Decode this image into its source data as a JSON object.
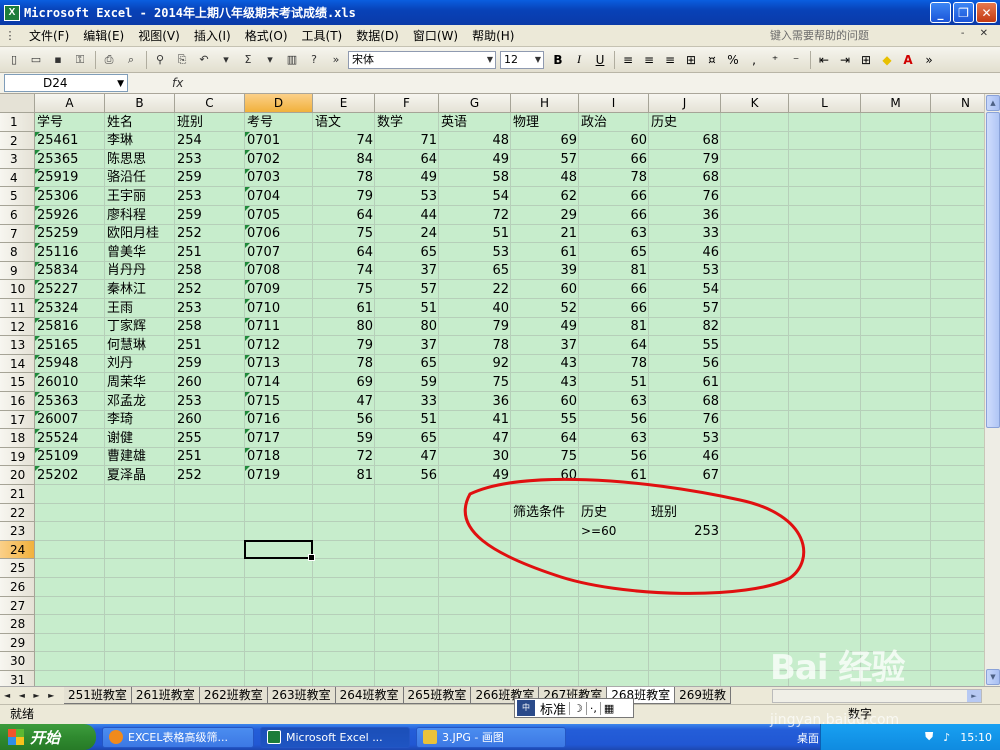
{
  "window": {
    "title": "Microsoft Excel - 2014年上期八年级期末考试成绩.xls",
    "app_icon": "X",
    "buttons": [
      "_",
      "❐",
      "✕"
    ]
  },
  "menu": {
    "items": [
      "文件(F)",
      "编辑(E)",
      "视图(V)",
      "插入(I)",
      "格式(O)",
      "工具(T)",
      "数据(D)",
      "窗口(W)",
      "帮助(H)"
    ],
    "help_placeholder": "键入需要帮助的问题",
    "help_close": "- ✕"
  },
  "toolbar": {
    "font_name": "宋体",
    "font_size": "12",
    "bold": "B",
    "italic": "I",
    "underline": "U",
    "sigma": "Σ",
    "percent": "%",
    "fx": "fx"
  },
  "formula_bar": {
    "name_box": "D24",
    "formula": ""
  },
  "sheet": {
    "columns": [
      "A",
      "B",
      "C",
      "D",
      "E",
      "F",
      "G",
      "H",
      "I",
      "J",
      "K",
      "L",
      "M",
      "N"
    ],
    "selected_column": "D",
    "selected_row": 24,
    "active_cell": "D24",
    "row_count": 31,
    "header": [
      "学号",
      "姓名",
      "班别",
      "考号",
      "语文",
      "数学",
      "英语",
      "物理",
      "政治",
      "历史"
    ],
    "rows": [
      [
        "25461",
        "李琳",
        "254",
        "0701",
        "74",
        "71",
        "48",
        "69",
        "60",
        "68"
      ],
      [
        "25365",
        "陈思思",
        "253",
        "0702",
        "84",
        "64",
        "49",
        "57",
        "66",
        "79"
      ],
      [
        "25919",
        "骆沿任",
        "259",
        "0703",
        "78",
        "49",
        "58",
        "48",
        "78",
        "68"
      ],
      [
        "25306",
        "王宇丽",
        "253",
        "0704",
        "79",
        "53",
        "54",
        "62",
        "66",
        "76"
      ],
      [
        "25926",
        "廖科程",
        "259",
        "0705",
        "64",
        "44",
        "72",
        "29",
        "66",
        "36"
      ],
      [
        "25259",
        "欧阳月桂",
        "252",
        "0706",
        "75",
        "24",
        "51",
        "21",
        "63",
        "33"
      ],
      [
        "25116",
        "曾美华",
        "251",
        "0707",
        "64",
        "65",
        "53",
        "61",
        "65",
        "46"
      ],
      [
        "25834",
        "肖丹丹",
        "258",
        "0708",
        "74",
        "37",
        "65",
        "39",
        "81",
        "53"
      ],
      [
        "25227",
        "秦林江",
        "252",
        "0709",
        "75",
        "57",
        "22",
        "60",
        "66",
        "54"
      ],
      [
        "25324",
        "王雨",
        "253",
        "0710",
        "61",
        "51",
        "40",
        "52",
        "66",
        "57"
      ],
      [
        "25816",
        "丁家辉",
        "258",
        "0711",
        "80",
        "80",
        "79",
        "49",
        "81",
        "82"
      ],
      [
        "25165",
        "何慧琳",
        "251",
        "0712",
        "79",
        "37",
        "78",
        "37",
        "64",
        "55"
      ],
      [
        "25948",
        "刘丹",
        "259",
        "0713",
        "78",
        "65",
        "92",
        "43",
        "78",
        "56"
      ],
      [
        "26010",
        "周茉华",
        "260",
        "0714",
        "69",
        "59",
        "75",
        "43",
        "51",
        "61"
      ],
      [
        "25363",
        "邓孟龙",
        "253",
        "0715",
        "47",
        "33",
        "36",
        "60",
        "63",
        "68"
      ],
      [
        "26007",
        "李琦",
        "260",
        "0716",
        "56",
        "51",
        "41",
        "55",
        "56",
        "76"
      ],
      [
        "25524",
        "谢健",
        "255",
        "0717",
        "59",
        "65",
        "47",
        "64",
        "63",
        "53"
      ],
      [
        "25109",
        "曹建雄",
        "251",
        "0718",
        "72",
        "47",
        "30",
        "75",
        "56",
        "46"
      ],
      [
        "25202",
        "夏泽晶",
        "252",
        "0719",
        "81",
        "56",
        "49",
        "60",
        "61",
        "67"
      ]
    ],
    "criteria": {
      "label": "筛选条件",
      "col1_header": "历史",
      "col2_header": "班别",
      "extra_header": "历史",
      "col1_value": ">=60",
      "col2_value": "253"
    }
  },
  "tabs": {
    "nav": "◄ ◄ ► ►",
    "items": [
      "251班教室",
      "261班教室",
      "262班教室",
      "263班教室",
      "264班教室",
      "265班教室",
      "266班教室",
      "267班教室",
      "268班教室",
      "269班教"
    ],
    "active": "268班教室"
  },
  "status": {
    "left": "就绪",
    "right": "数字"
  },
  "ime": {
    "logo": "中",
    "mode": "标准",
    "moon": "☽",
    "punct": "·,"
  },
  "taskbar": {
    "start": "开始",
    "tasks": [
      "EXCEL表格高级筛...",
      "Microsoft Excel ...",
      "3.JPG - 画图"
    ],
    "desktop": "桌面",
    "clock": "15:10"
  },
  "watermark": {
    "logo": "Bai 经验",
    "url": "jingyan.baidu.com"
  },
  "colors": {
    "cell_bg": "#c7edcc",
    "annotation": "#e01010",
    "selection": "#f1b13c"
  }
}
